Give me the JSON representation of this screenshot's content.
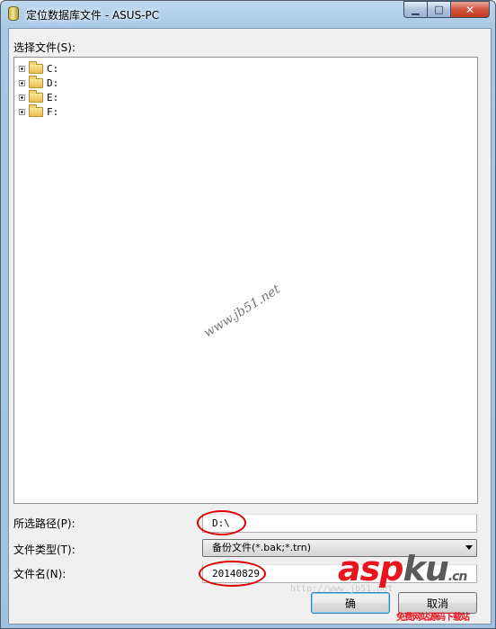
{
  "window": {
    "title": "定位数据库文件 - ASUS-PC",
    "minimize_glyph": "▁",
    "maximize_glyph": "□",
    "close_glyph": "✕"
  },
  "tree": {
    "label": "选择文件(S):",
    "drives": [
      {
        "label": "C:"
      },
      {
        "label": "D:"
      },
      {
        "label": "E:"
      },
      {
        "label": "F:"
      }
    ]
  },
  "watermark": "www.jb51.net",
  "path": {
    "label": "所选路径(P):",
    "value": "D:\\"
  },
  "file_type": {
    "label": "文件类型(T):",
    "selected": "备份文件(*.bak;*.trn)"
  },
  "file_name": {
    "label": "文件名(N):",
    "value": "20140829"
  },
  "buttons": {
    "ok_label": "确",
    "cancel_label": "取消"
  },
  "logo": {
    "asp": "asp",
    "ku": "ku",
    "suffix": ".cn",
    "tagline": "免费网站源码下载站",
    "faded_url": "http://www.jb51.net"
  },
  "colors": {
    "annotation_red": "#e00000",
    "logo_red": "#e8141e"
  }
}
